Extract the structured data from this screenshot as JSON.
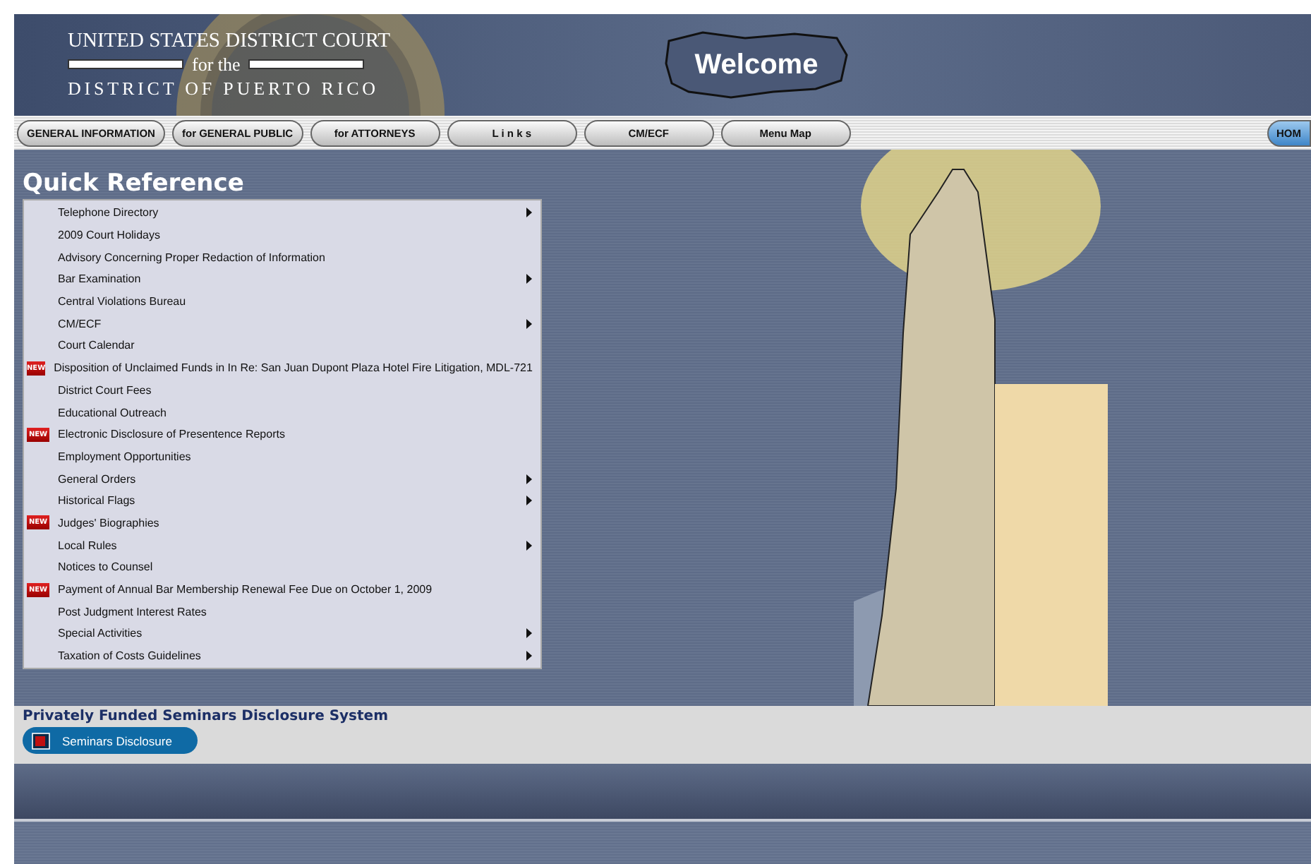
{
  "header": {
    "title_lines": [
      "UNITED STATES DISTRICT COURT",
      "for the",
      "DISTRICT OF PUERTO RICO"
    ],
    "welcome": "Welcome"
  },
  "nav": [
    {
      "label": "GENERAL INFORMATION",
      "selected": false
    },
    {
      "label": "for GENERAL PUBLIC",
      "selected": false
    },
    {
      "label": "for ATTORNEYS",
      "selected": false
    },
    {
      "label": "L i n k s",
      "selected": false
    },
    {
      "label": "CM/ECF",
      "selected": false
    },
    {
      "label": "Menu Map",
      "selected": false
    },
    {
      "label": "HOM",
      "selected": true
    }
  ],
  "quick_reference": {
    "title": "Quick Reference",
    "items": [
      {
        "label": "Telephone Directory",
        "submenu": true
      },
      {
        "label": "2009 Court Holidays",
        "submenu": false
      },
      {
        "label": "Advisory Concerning Proper Redaction of Information",
        "submenu": false
      },
      {
        "label": "Bar Examination",
        "submenu": true
      },
      {
        "label": "Central Violations Bureau",
        "submenu": false
      },
      {
        "label": "CM/ECF",
        "submenu": true
      },
      {
        "label": "Court Calendar",
        "submenu": false
      },
      {
        "label": "Disposition of Unclaimed Funds in In Re: San Juan Dupont Plaza Hotel Fire Litigation, MDL-721",
        "submenu": false,
        "badge": "NEW"
      },
      {
        "label": "District Court Fees",
        "submenu": false
      },
      {
        "label": "Educational Outreach",
        "submenu": false
      },
      {
        "label": "Electronic Disclosure of Presentence Reports",
        "submenu": false,
        "badge": "NEW"
      },
      {
        "label": "Employment Opportunities",
        "submenu": false
      },
      {
        "label": "General Orders",
        "submenu": true
      },
      {
        "label": "Historical Flags",
        "submenu": true
      },
      {
        "label": "Judges' Biographies",
        "submenu": false,
        "badge": "NEW"
      },
      {
        "label": "Local Rules",
        "submenu": true
      },
      {
        "label": "Notices to Counsel",
        "submenu": false
      },
      {
        "label": "Payment of Annual Bar Membership Renewal Fee Due on October 1, 2009",
        "submenu": false,
        "badge": "NEW"
      },
      {
        "label": "Post Judgment Interest Rates",
        "submenu": false
      },
      {
        "label": "Special Activities",
        "submenu": true
      },
      {
        "label": "Taxation of Costs Guidelines",
        "submenu": true
      }
    ]
  },
  "seminars": {
    "title": "Privately Funded Seminars Disclosure System",
    "button": "Seminars Disclosure"
  }
}
